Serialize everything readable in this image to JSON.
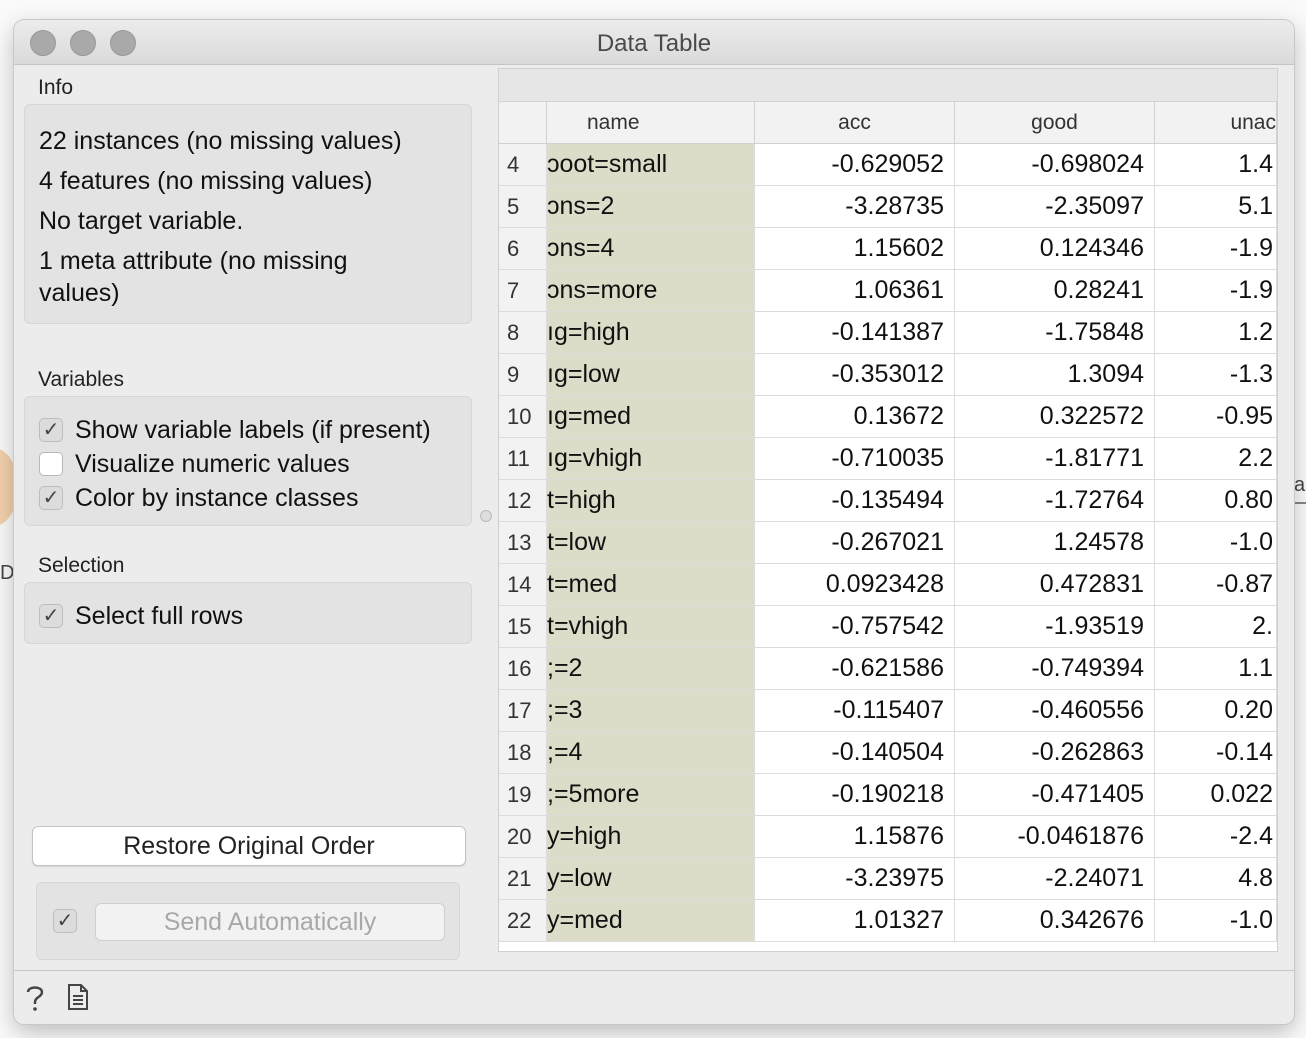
{
  "window": {
    "title": "Data Table"
  },
  "background": {
    "left_text": "Da",
    "right_text": "a"
  },
  "info": {
    "label": "Info",
    "lines": [
      "22 instances (no missing values)",
      "4 features (no missing values)",
      "No target variable.",
      "1 meta attribute (no missing",
      "values)"
    ]
  },
  "variables": {
    "label": "Variables",
    "options": [
      {
        "label": "Show variable labels (if present)",
        "checked": true
      },
      {
        "label": "Visualize numeric values",
        "checked": false
      },
      {
        "label": "Color by instance classes",
        "checked": true
      }
    ]
  },
  "selection": {
    "label": "Selection",
    "options": [
      {
        "label": "Select full rows",
        "checked": true
      }
    ]
  },
  "buttons": {
    "restore": "Restore Original Order",
    "send": "Send Automatically",
    "send_auto_checked": true
  },
  "table": {
    "headers": {
      "name": "name",
      "acc": "acc",
      "good": "good",
      "unacc": "unac"
    },
    "rows": [
      {
        "idx": "4",
        "name": "ɔoot=small",
        "acc": "-0.629052",
        "good": "-0.698024",
        "unacc": "1.4"
      },
      {
        "idx": "5",
        "name": "ɔns=2",
        "acc": "-3.28735",
        "good": "-2.35097",
        "unacc": "5.1"
      },
      {
        "idx": "6",
        "name": "ɔns=4",
        "acc": "1.15602",
        "good": "0.124346",
        "unacc": "-1.9"
      },
      {
        "idx": "7",
        "name": "ɔns=more",
        "acc": "1.06361",
        "good": "0.28241",
        "unacc": "-1.9"
      },
      {
        "idx": "8",
        "name": "ıg=high",
        "acc": "-0.141387",
        "good": "-1.75848",
        "unacc": "1.2"
      },
      {
        "idx": "9",
        "name": "ıg=low",
        "acc": "-0.353012",
        "good": "1.3094",
        "unacc": "-1.3"
      },
      {
        "idx": "10",
        "name": "ıg=med",
        "acc": "0.13672",
        "good": "0.322572",
        "unacc": "-0.95"
      },
      {
        "idx": "11",
        "name": "ıg=vhigh",
        "acc": "-0.710035",
        "good": "-1.81771",
        "unacc": "2.2"
      },
      {
        "idx": "12",
        "name": "t=high",
        "acc": "-0.135494",
        "good": "-1.72764",
        "unacc": "0.80"
      },
      {
        "idx": "13",
        "name": "t=low",
        "acc": "-0.267021",
        "good": "1.24578",
        "unacc": "-1.0"
      },
      {
        "idx": "14",
        "name": "t=med",
        "acc": "0.0923428",
        "good": "0.472831",
        "unacc": "-0.87"
      },
      {
        "idx": "15",
        "name": "t=vhigh",
        "acc": "-0.757542",
        "good": "-1.93519",
        "unacc": "2."
      },
      {
        "idx": "16",
        "name": ";=2",
        "acc": "-0.621586",
        "good": "-0.749394",
        "unacc": "1.1"
      },
      {
        "idx": "17",
        "name": ";=3",
        "acc": "-0.115407",
        "good": "-0.460556",
        "unacc": "0.20"
      },
      {
        "idx": "18",
        "name": ";=4",
        "acc": "-0.140504",
        "good": "-0.262863",
        "unacc": "-0.14"
      },
      {
        "idx": "19",
        "name": ";=5more",
        "acc": "-0.190218",
        "good": "-0.471405",
        "unacc": "0.022"
      },
      {
        "idx": "20",
        "name": "y=high",
        "acc": "1.15876",
        "good": "-0.0461876",
        "unacc": "-2.4"
      },
      {
        "idx": "21",
        "name": "y=low",
        "acc": "-3.23975",
        "good": "-2.24071",
        "unacc": "4.8"
      },
      {
        "idx": "22",
        "name": "y=med",
        "acc": "1.01327",
        "good": "0.342676",
        "unacc": "-1.0"
      }
    ]
  },
  "statusbar": {
    "help_icon": "question-mark-icon",
    "report_icon": "document-icon"
  }
}
